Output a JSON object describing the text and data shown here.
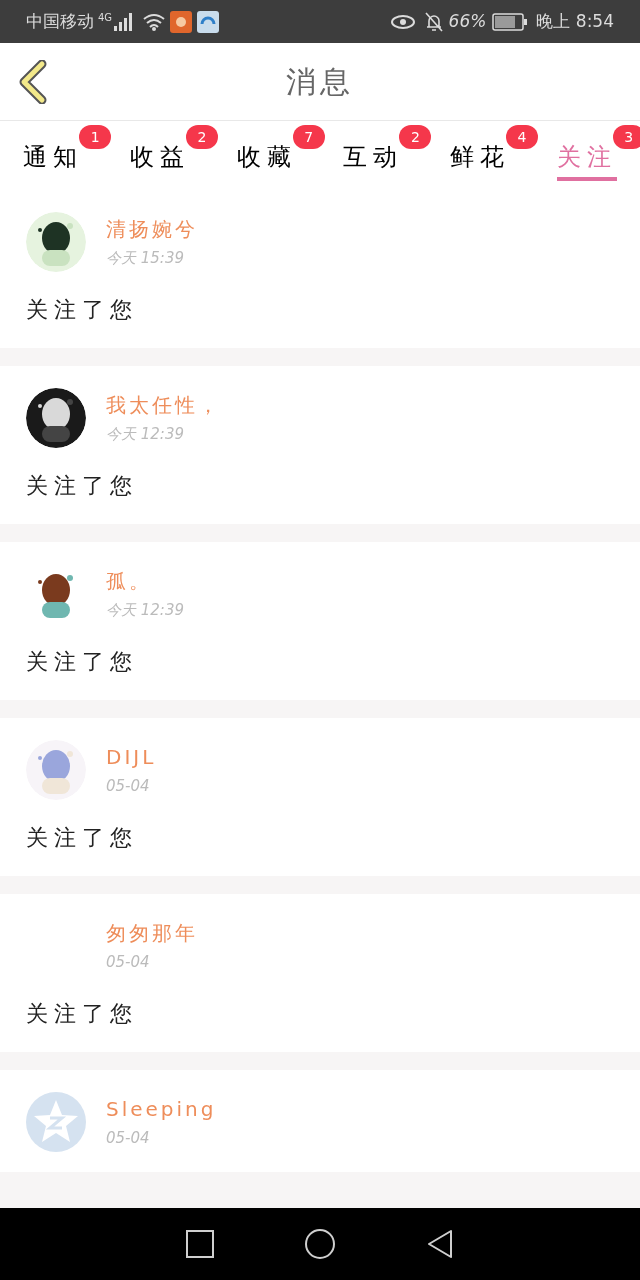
{
  "status_bar": {
    "carrier": "中国移动",
    "network": "4G",
    "battery": "66%",
    "time": "晚上 8:54"
  },
  "header": {
    "title": "消息"
  },
  "tabs": [
    {
      "label": "通知",
      "badge": "1",
      "selected": false
    },
    {
      "label": "收益",
      "badge": "2",
      "selected": false
    },
    {
      "label": "收藏",
      "badge": "7",
      "selected": false
    },
    {
      "label": "互动",
      "badge": "2",
      "selected": false
    },
    {
      "label": "鲜花",
      "badge": "4",
      "selected": false
    },
    {
      "label": "关注",
      "badge": "3",
      "selected": true
    }
  ],
  "messages": [
    {
      "name": "清扬婉兮",
      "time": "今天 15:39",
      "text": "关注了您"
    },
    {
      "name": "我太任性，",
      "time": "今天 12:39",
      "text": "关注了您"
    },
    {
      "name": "孤。",
      "time": "今天 12:39",
      "text": "关注了您"
    },
    {
      "name": "DIJL",
      "time": "05-04",
      "text": "关注了您"
    },
    {
      "name": "匆匆那年",
      "time": "05-04",
      "text": "关注了您"
    },
    {
      "avatar": {
        "kind": "star"
      },
      "name": "Sleeping",
      "time": "05-04"
    }
  ]
}
